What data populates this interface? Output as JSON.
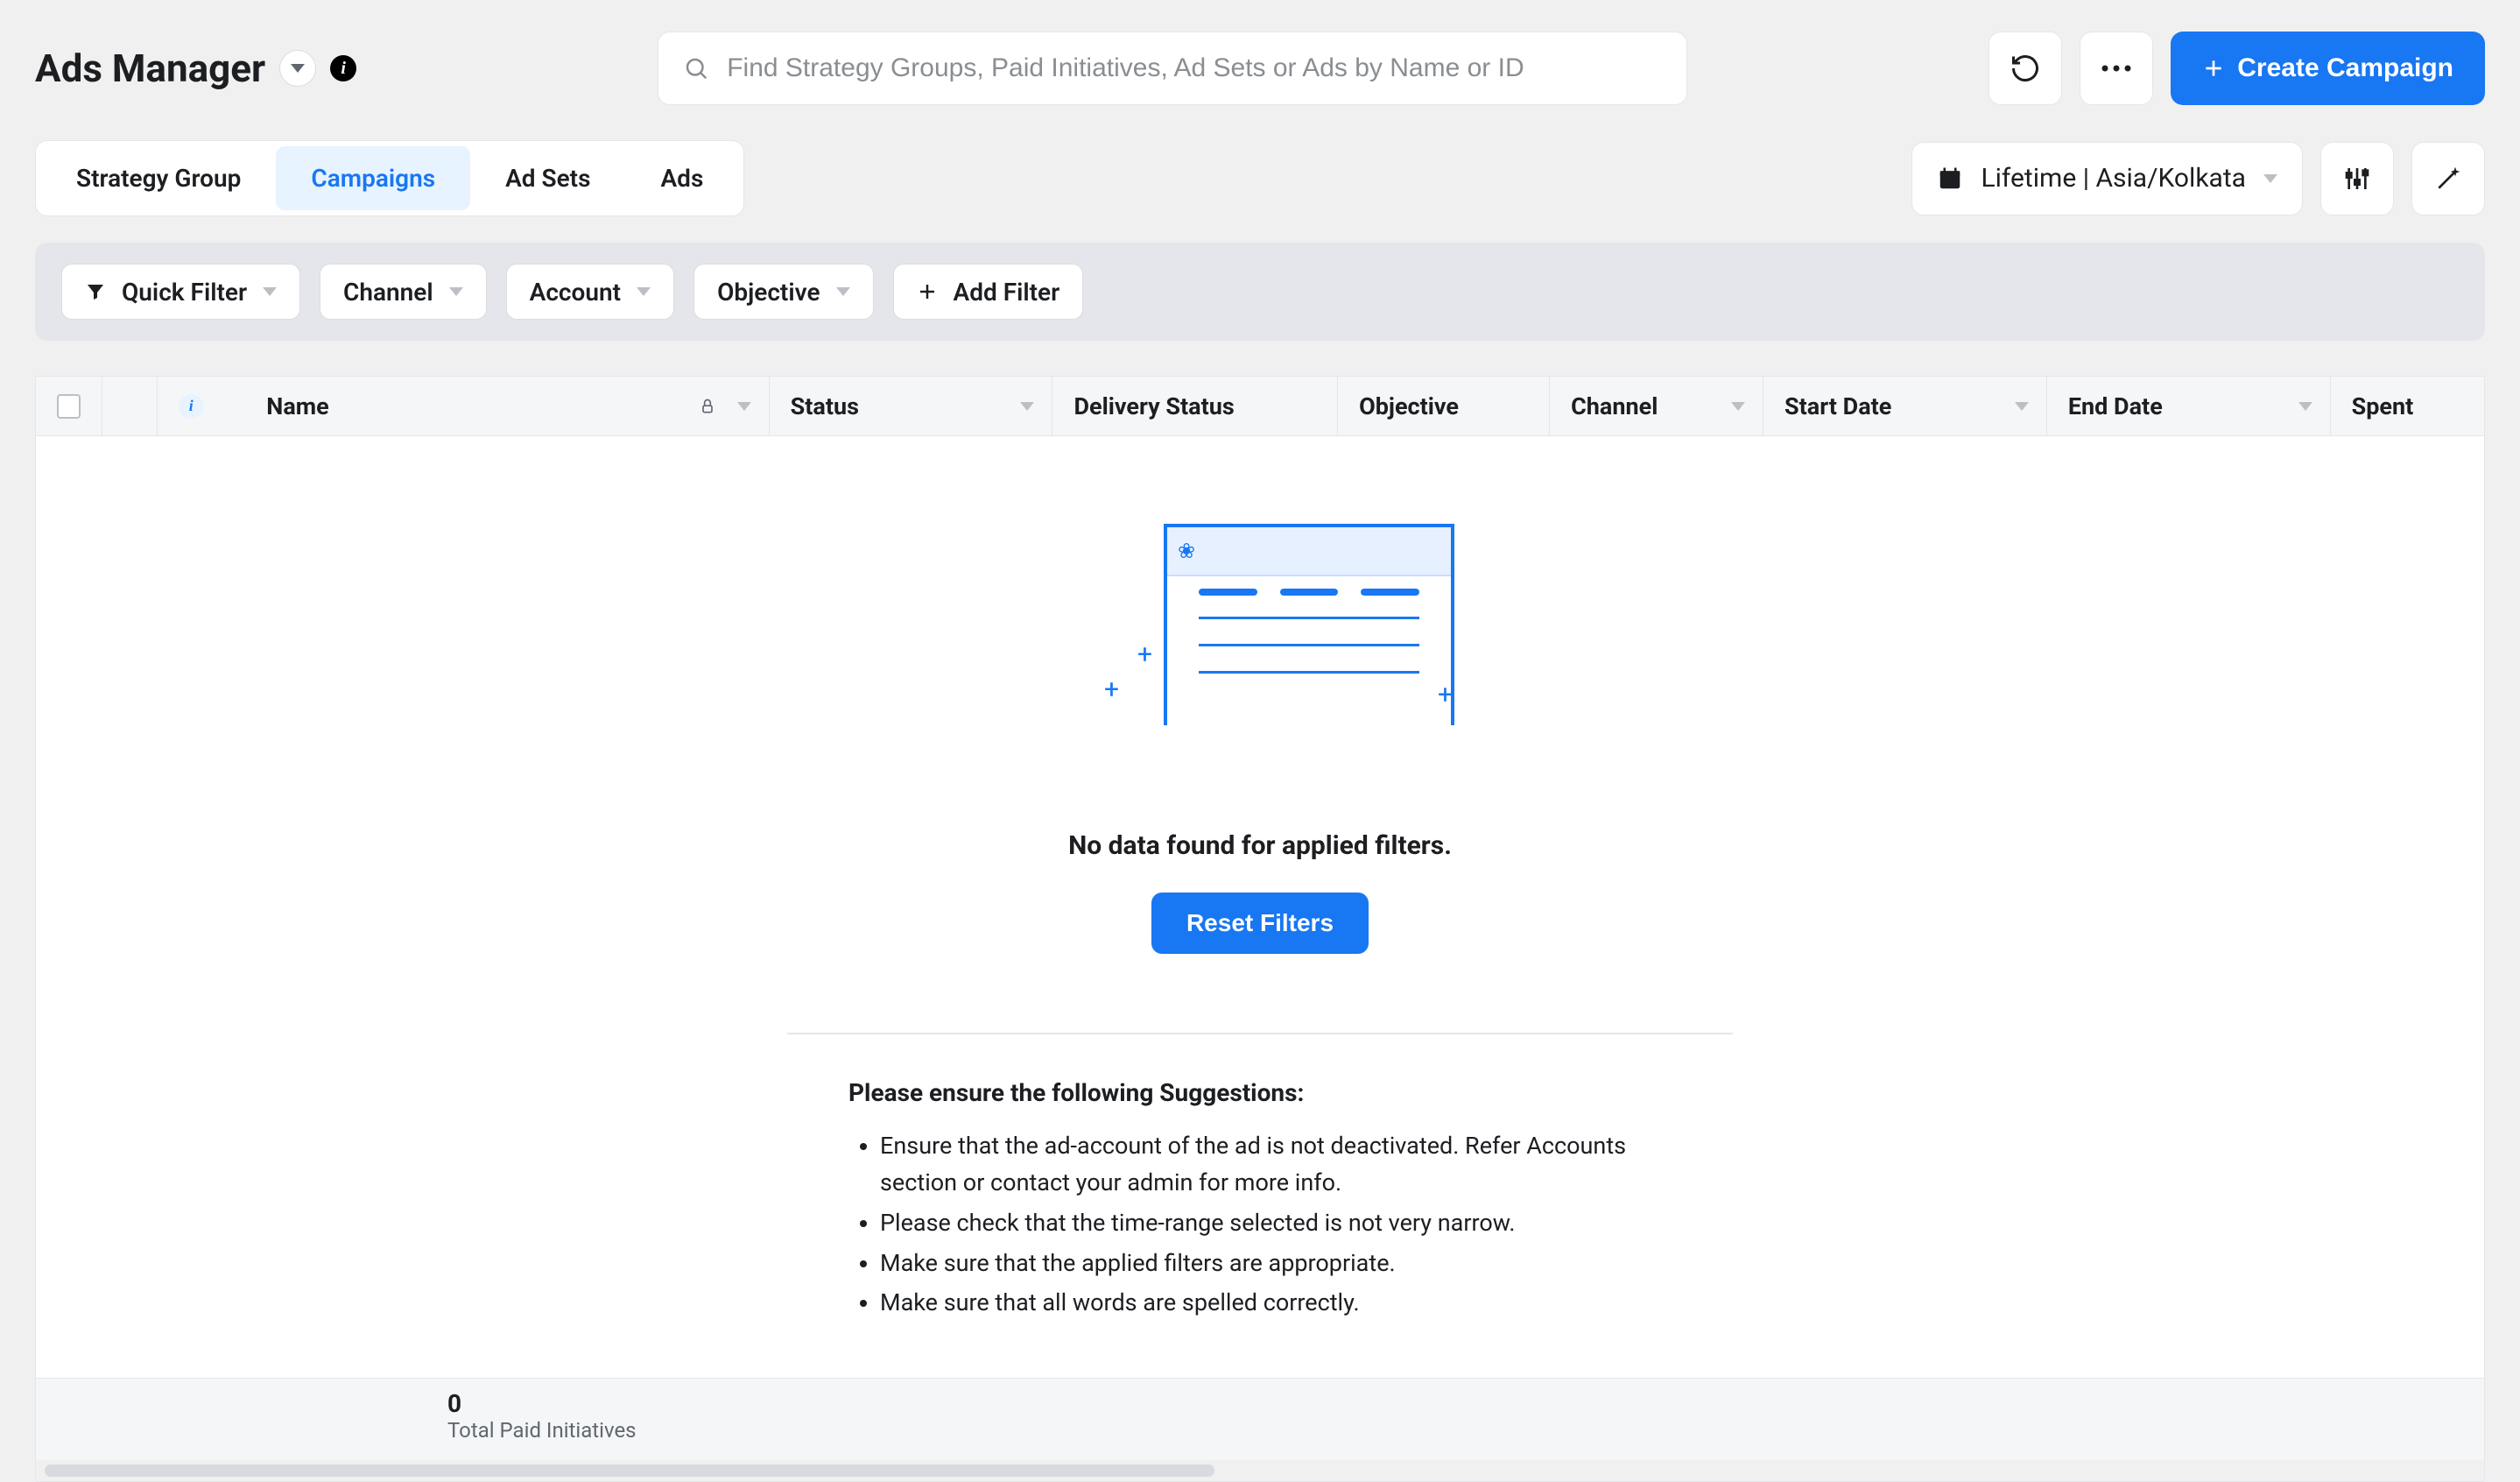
{
  "header": {
    "title": "Ads Manager",
    "search_placeholder": "Find Strategy Groups, Paid Initiatives, Ad Sets or Ads by Name or ID",
    "create_label": "Create Campaign"
  },
  "tabs": [
    {
      "label": "Strategy Group",
      "active": false
    },
    {
      "label": "Campaigns",
      "active": true
    },
    {
      "label": "Ad Sets",
      "active": false
    },
    {
      "label": "Ads",
      "active": false
    }
  ],
  "date_range": "Lifetime | Asia/Kolkata",
  "filters": {
    "quick": "Quick Filter",
    "channel": "Channel",
    "account": "Account",
    "objective": "Objective",
    "add": "Add Filter"
  },
  "columns": {
    "name": "Name",
    "status": "Status",
    "delivery": "Delivery Status",
    "objective": "Objective",
    "channel": "Channel",
    "start": "Start Date",
    "end": "End Date",
    "spent": "Spent"
  },
  "empty": {
    "title": "No data found for applied filters.",
    "reset": "Reset Filters",
    "suggestions_title": "Please ensure the following Suggestions:",
    "suggestions": [
      "Ensure that the ad-account of the ad is not deactivated. Refer Accounts section or contact your admin for more info.",
      "Please check that the time-range selected is not very narrow.",
      "Make sure that the applied filters are appropriate.",
      "Make sure that all words are spelled correctly."
    ]
  },
  "footer": {
    "count": "0",
    "label": "Total Paid Initiatives"
  }
}
